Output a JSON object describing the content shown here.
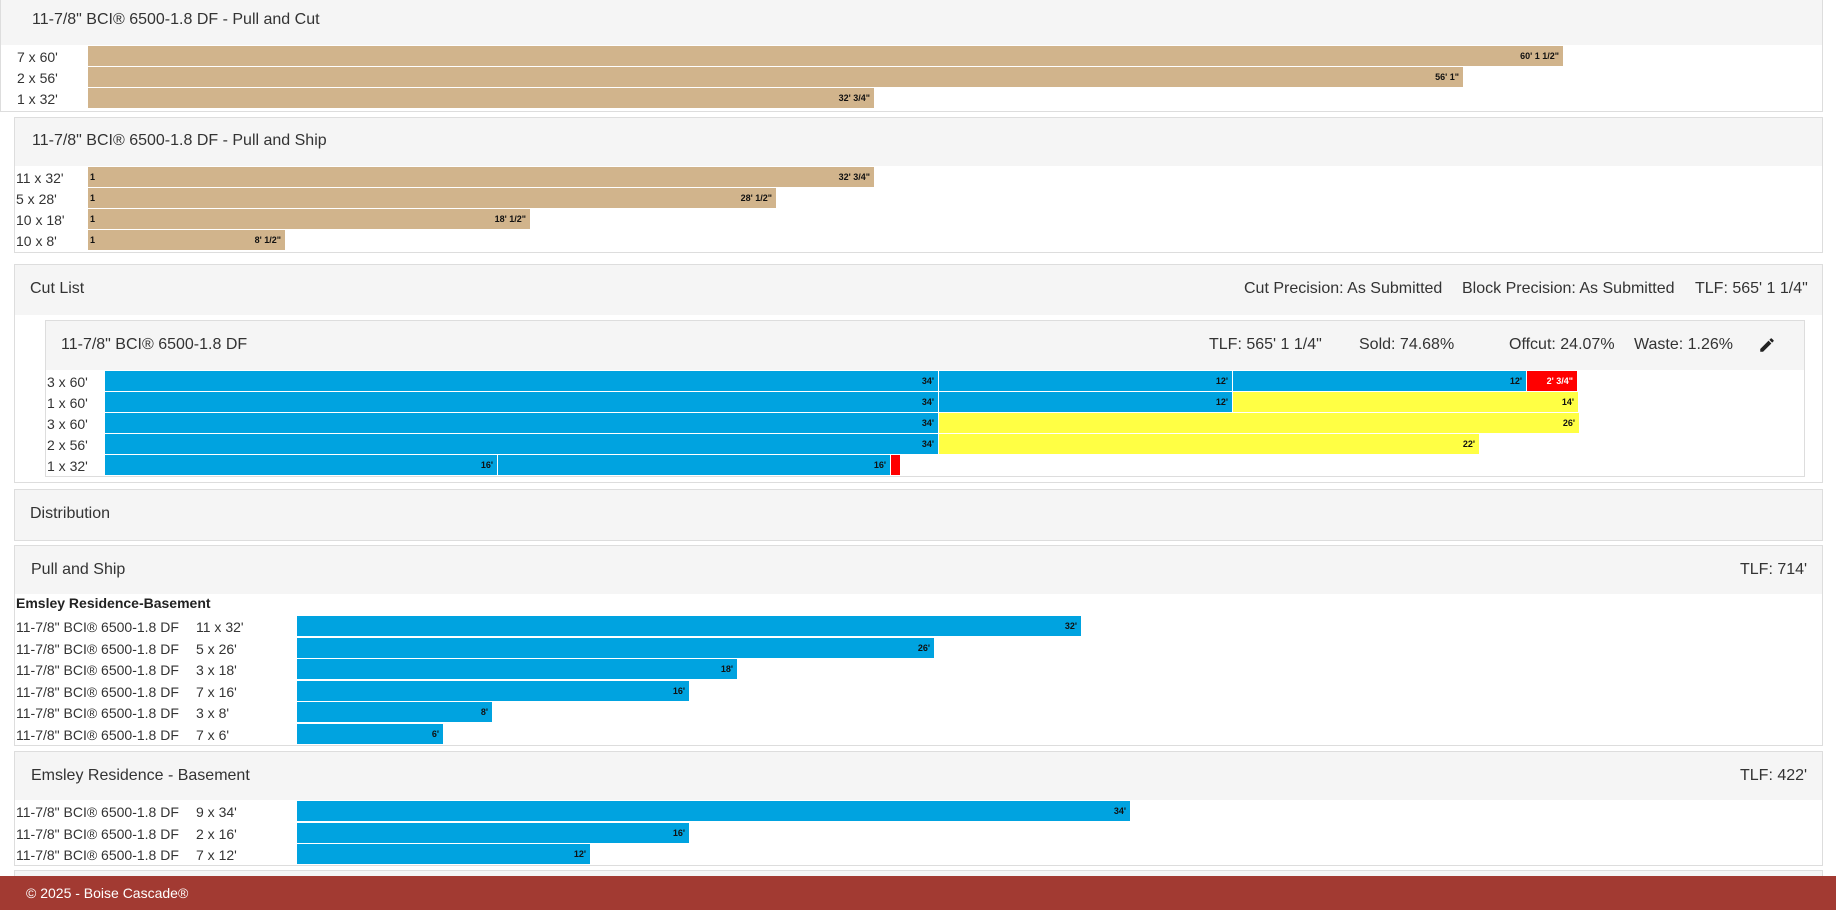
{
  "pull_cut": {
    "title": "11-7/8\" BCI® 6500-1.8 DF - Pull and Cut",
    "rows": [
      {
        "label": "7 x 60'",
        "bar": "60' 1 1/2\""
      },
      {
        "label": "2 x 56'",
        "bar": "56' 1\""
      },
      {
        "label": "1 x 32'",
        "bar": "32' 3/4\""
      }
    ]
  },
  "pull_ship_top": {
    "title": "11-7/8\" BCI® 6500-1.8 DF - Pull and Ship",
    "rows": [
      {
        "label": "11 x 32'",
        "count": "1",
        "bar": "32' 3/4\""
      },
      {
        "label": "5 x 28'",
        "count": "1",
        "bar": "28' 1/2\""
      },
      {
        "label": "10 x 18'",
        "count": "1",
        "bar": "18' 1/2\""
      },
      {
        "label": "10 x 8'",
        "count": "1",
        "bar": "8' 1/2\""
      }
    ]
  },
  "cut_list": {
    "title": "Cut List",
    "cut_precision": "Cut Precision: As Submitted",
    "block_precision": "Block Precision: As Submitted",
    "tlf": "TLF: 565' 1 1/4\"",
    "product": {
      "title": "11-7/8\" BCI® 6500-1.8 DF",
      "tlf": "TLF: 565' 1 1/4\"",
      "sold": "Sold: 74.68%",
      "offcut": "Offcut: 24.07%",
      "waste": "Waste: 1.26%",
      "edit_icon": "pencil-icon",
      "rows": [
        {
          "label": "3 x 60'",
          "segments": [
            {
              "type": "cut",
              "label": "34'"
            },
            {
              "type": "cut",
              "label": "12'"
            },
            {
              "type": "cut",
              "label": "12'"
            },
            {
              "type": "waste",
              "label": "2' 3/4\""
            }
          ]
        },
        {
          "label": "1 x 60'",
          "segments": [
            {
              "type": "cut",
              "label": "34'"
            },
            {
              "type": "cut",
              "label": "12'"
            },
            {
              "type": "offcut",
              "label": "14'"
            }
          ]
        },
        {
          "label": "3 x 60'",
          "segments": [
            {
              "type": "cut",
              "label": "34'"
            },
            {
              "type": "offcut",
              "label": "26'"
            }
          ]
        },
        {
          "label": "2 x 56'",
          "segments": [
            {
              "type": "cut",
              "label": "34'"
            },
            {
              "type": "offcut",
              "label": "22'"
            }
          ]
        },
        {
          "label": "1 x 32'",
          "segments": [
            {
              "type": "cut",
              "label": "16'"
            },
            {
              "type": "cut",
              "label": "16'"
            },
            {
              "type": "waste",
              "label": ""
            }
          ]
        }
      ]
    }
  },
  "distribution": {
    "title": "Distribution"
  },
  "dist_pull_ship": {
    "title": "Pull and Ship",
    "tlf": "TLF: 714'",
    "group": "Emsley Residence-Basement",
    "rows": [
      {
        "product": "11-7/8\" BCI® 6500-1.8 DF",
        "qty": "11 x 32'",
        "bar": "32'"
      },
      {
        "product": "11-7/8\" BCI® 6500-1.8 DF",
        "qty": "5 x 26'",
        "bar": "26'"
      },
      {
        "product": "11-7/8\" BCI® 6500-1.8 DF",
        "qty": "3 x 18'",
        "bar": "18'"
      },
      {
        "product": "11-7/8\" BCI® 6500-1.8 DF",
        "qty": "7 x 16'",
        "bar": "16'"
      },
      {
        "product": "11-7/8\" BCI® 6500-1.8 DF",
        "qty": "3 x 8'",
        "bar": "8'"
      },
      {
        "product": "11-7/8\" BCI® 6500-1.8 DF",
        "qty": "7 x 6'",
        "bar": "6'"
      }
    ]
  },
  "emsley_basement": {
    "title": "Emsley Residence - Basement",
    "tlf": "TLF: 422'",
    "rows": [
      {
        "product": "11-7/8\" BCI® 6500-1.8 DF",
        "qty": "9 x 34'",
        "bar": "34'"
      },
      {
        "product": "11-7/8\" BCI® 6500-1.8 DF",
        "qty": "2 x 16'",
        "bar": "16'"
      },
      {
        "product": "11-7/8\" BCI® 6500-1.8 DF",
        "qty": "7 x 12'",
        "bar": "12'"
      }
    ]
  },
  "colors": {
    "stock": "#d1b48c",
    "cut": "#00a3e0",
    "offcut": "#ffff44",
    "waste": "#ff0000",
    "footer": "#a23a32"
  },
  "footer": {
    "text": "© 2025 - Boise Cascade®"
  }
}
